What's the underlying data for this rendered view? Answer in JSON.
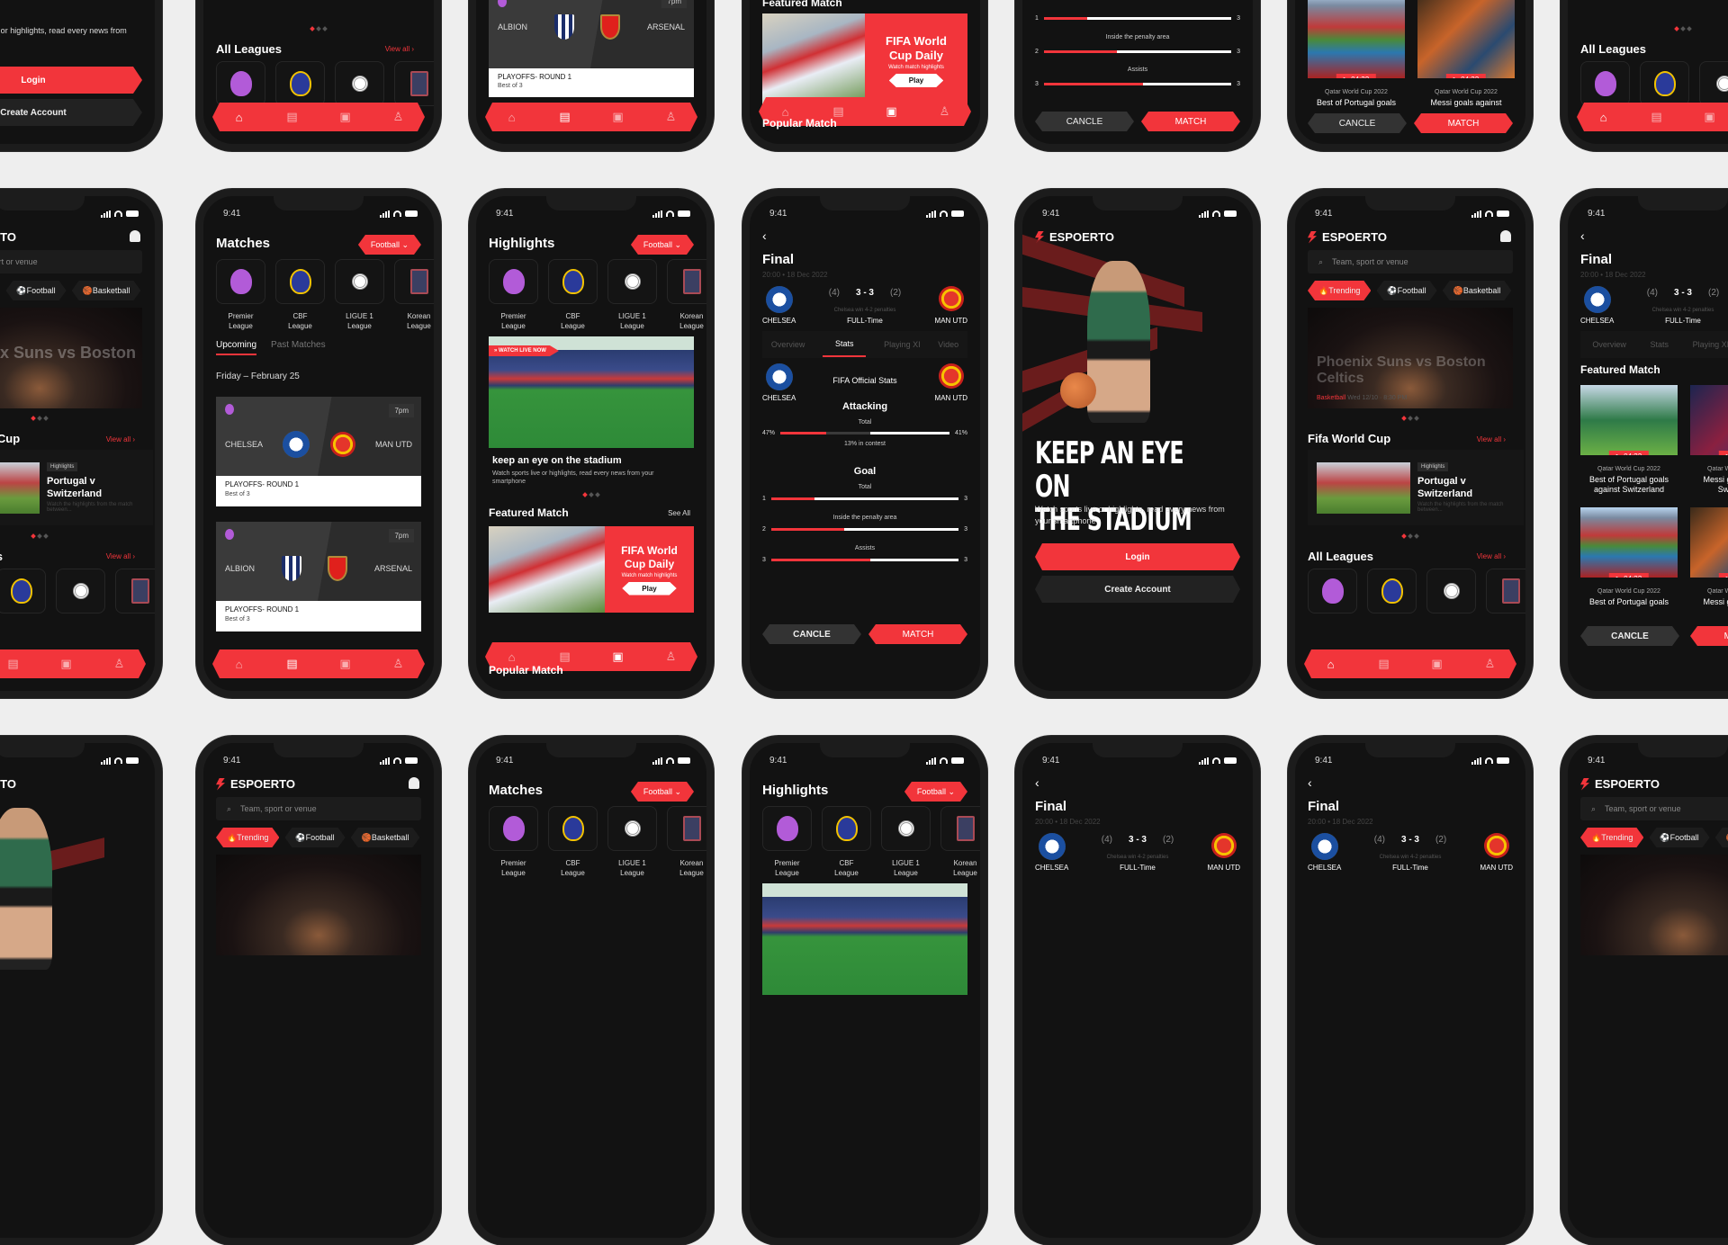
{
  "app": {
    "brand": "ESPOERTO",
    "status_time": "9:41",
    "accent_color": "#f2353b",
    "background_color": "#121212"
  },
  "common": {
    "search_placeholder": "Team, sport or venue",
    "chips": [
      {
        "label": "Trending",
        "icon": "fire-icon"
      },
      {
        "label": "Football",
        "icon": "football-icon"
      },
      {
        "label": "Basketball",
        "icon": "basketball-icon"
      }
    ],
    "view_all": "View all",
    "see_all": "See All",
    "sport_select": "Football",
    "leagues": [
      {
        "line1": "Premier",
        "line2": "League"
      },
      {
        "line1": "CBF",
        "line2": "League"
      },
      {
        "line1": "LIGUE 1",
        "line2": "League"
      },
      {
        "line1": "Korean",
        "line2": "League"
      }
    ],
    "tabbar": [
      "home-icon",
      "news-icon",
      "video-icon",
      "profile-icon"
    ]
  },
  "onboarding": {
    "headline_line1": "KEEP AN EYE ON",
    "headline_line2": "THE STADIUM",
    "subtitle": "Watch sports live or highlights, read every news from your smartphone",
    "login": "Login",
    "create_account": "Create Account"
  },
  "home": {
    "hero_category": "Basketball",
    "hero_date": "Wed 12/10 · 8:30 PM",
    "hero_title": "Phoenix Suns vs Boston Celtics",
    "section_worldcup": "Fifa World Cup",
    "highlight_tag": "Highlights",
    "highlight_title": "Portugal v Switzerland",
    "highlight_desc": "Watch the highlights from the match between...",
    "section_leagues": "All Leagues"
  },
  "matches": {
    "title": "Matches",
    "tabs": [
      "Upcoming",
      "Past Matches"
    ],
    "date": "Friday – February 25",
    "items": [
      {
        "home": "CHELSEA",
        "away": "MAN UTD",
        "time": "7pm",
        "round": "PLAYOFFS- ROUND 1",
        "format": "Best of 3"
      },
      {
        "home": "ALBION",
        "away": "ARSENAL",
        "time": "7pm",
        "round": "PLAYOFFS- ROUND 1",
        "format": "Best of 3"
      }
    ]
  },
  "highlights": {
    "title": "Highlights",
    "live_badge": "WATCH LIVE NOW",
    "banner_title": "keep an eye on the stadium",
    "banner_desc": "Watch sports live or highlights, read every news from your smartphone",
    "featured_title": "Featured Match",
    "featured_promo_title": "FIFA World Cup Daily",
    "featured_promo_sub": "Watch match highlights",
    "play": "Play",
    "popular_title": "Popular Match"
  },
  "final": {
    "title": "Final",
    "datetime": "20:00 • 18 Dec 2022",
    "home": "CHELSEA",
    "away": "MAN UTD",
    "pen_home": "(4)",
    "score": "3 - 3",
    "pen_away": "(2)",
    "note": "Chelsea win 4-2 penalties",
    "status": "FULL-Time",
    "tabs": [
      "Overview",
      "Stats",
      "Playing XI",
      "Video"
    ],
    "active_tab": 1,
    "stats_title": "FIFA Official Stats",
    "attacking": {
      "title": "Attacking",
      "label": "Total",
      "home_pct": "47%",
      "away_pct": "41%",
      "home_fill": 0.27,
      "contest_fill": 0.26,
      "contest": "13% in contest"
    },
    "goal": {
      "title": "Goal",
      "rows": [
        {
          "label": "Total",
          "home": "1",
          "away": "3",
          "fill": 0.23
        },
        {
          "label": "Inside the penalty area",
          "home": "2",
          "away": "3",
          "fill": 0.39
        },
        {
          "label": "Assists",
          "home": "3",
          "away": "3",
          "fill": 0.53
        }
      ]
    },
    "cancel": "CANCLE",
    "match": "MATCH",
    "featured_title": "Featured Match",
    "videos": [
      {
        "duration": "04:22",
        "sub": "Qatar World Cup 2022",
        "title": "Best of Portugal goals against Switzerland"
      },
      {
        "duration": "04:22",
        "sub": "Qatar World Cup 2022",
        "title": "Messi goals against Switzerland"
      },
      {
        "duration": "04:22",
        "sub": "Qatar World Cup 2022",
        "title": "Best of Portugal goals"
      },
      {
        "duration": "04:22",
        "sub": "Qatar World Cup 2022",
        "title": "Messi goals against"
      }
    ]
  }
}
